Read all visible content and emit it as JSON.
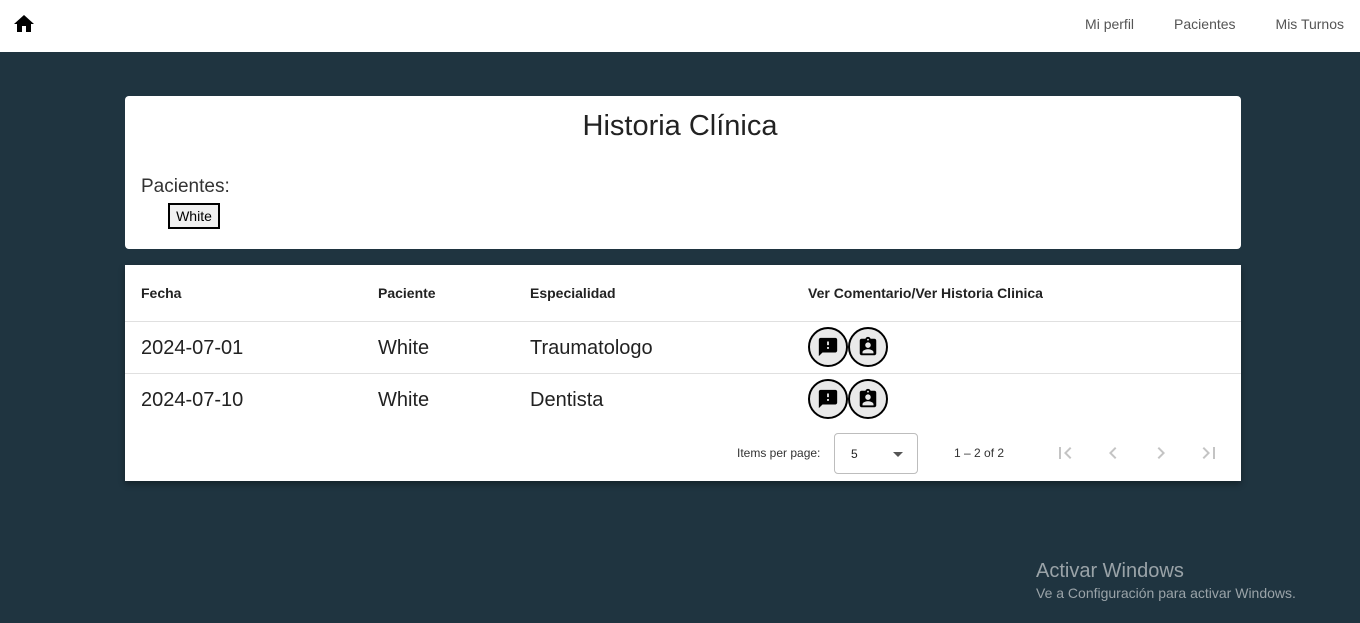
{
  "navbar": {
    "home_icon": "home-icon",
    "links": [
      "Mi perfil",
      "Pacientes",
      "Mis Turnos"
    ]
  },
  "header_card": {
    "title": "Historia Clínica",
    "patients_label": "Pacientes:",
    "patient_chip": "White"
  },
  "table": {
    "columns": [
      "Fecha",
      "Paciente",
      "Especialidad",
      "Ver Comentario/Ver Historia Clinica"
    ],
    "rows": [
      {
        "fecha": "2024-07-01",
        "paciente": "White",
        "especialidad": "Traumatologo"
      },
      {
        "fecha": "2024-07-10",
        "paciente": "White",
        "especialidad": "Dentista"
      }
    ],
    "action_icons": [
      "comment-alert-icon",
      "medical-record-icon"
    ]
  },
  "paginator": {
    "items_per_page_label": "Items per page:",
    "page_size": "5",
    "range": "1 – 2 of 2",
    "buttons": [
      "first-page-icon",
      "previous-page-icon",
      "next-page-icon",
      "last-page-icon"
    ]
  },
  "watermark": {
    "title": "Activar Windows",
    "subtitle": "Ve a Configuración para activar Windows."
  },
  "colors": {
    "background": "#1f3440",
    "card": "#ffffff",
    "watermark": "#9aa3a8"
  }
}
